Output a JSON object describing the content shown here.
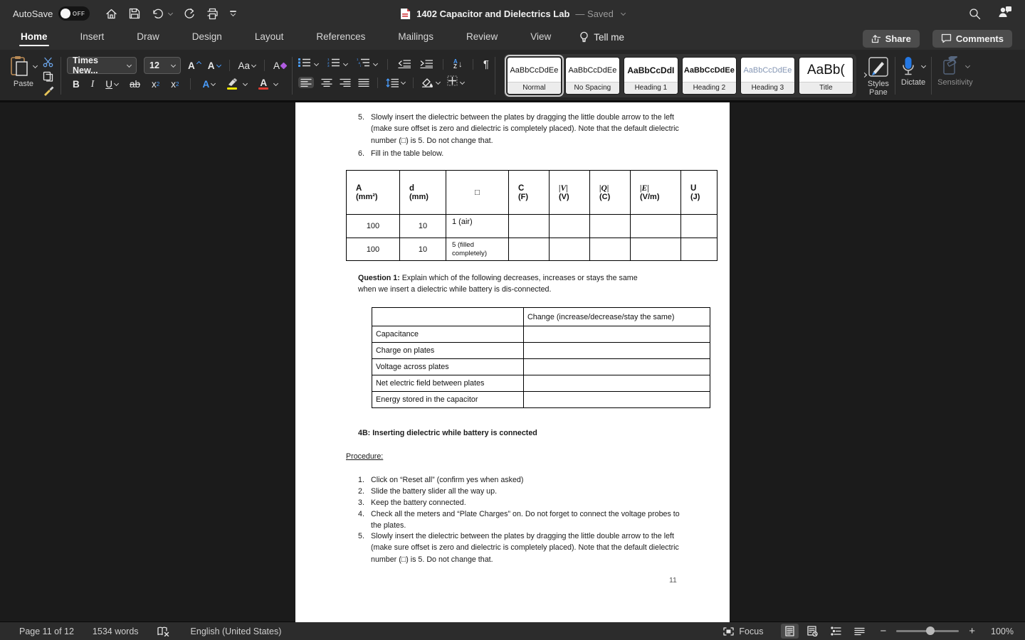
{
  "topbar": {
    "autosave_label": "AutoSave",
    "autosave_state": "OFF",
    "title": "1402 Capacitor and Dielectrics Lab",
    "title_status": "— Saved"
  },
  "tabs": [
    "Home",
    "Insert",
    "Draw",
    "Design",
    "Layout",
    "References",
    "Mailings",
    "Review",
    "View"
  ],
  "tellme_label": "Tell me",
  "header_buttons": {
    "share": "Share",
    "comments": "Comments"
  },
  "ribbon": {
    "paste_label": "Paste",
    "font_name": "Times New...",
    "font_size": "12",
    "bold": "B",
    "italic": "I",
    "underline": "U",
    "strike": "ab",
    "case_label": "Aa",
    "styles": [
      {
        "preview": "AaBbCcDdEe",
        "label": "Normal"
      },
      {
        "preview": "AaBbCcDdEe",
        "label": "No Spacing"
      },
      {
        "preview": "AaBbCcDdI",
        "label": "Heading 1"
      },
      {
        "preview": "AaBbCcDdEe",
        "label": "Heading 2"
      },
      {
        "preview": "AaBbCcDdEe",
        "label": "Heading 3"
      },
      {
        "preview": "AaBb(",
        "label": "Title"
      }
    ],
    "styles_pane_label1": "Styles",
    "styles_pane_label2": "Pane",
    "dictate_label": "Dictate",
    "sensitivity_label": "Sensitivity",
    "sort_a": "A",
    "sort_z": "Z",
    "pilcrow": "¶"
  },
  "document": {
    "intro_items": [
      {
        "num": "5.",
        "text": "Slowly insert the dielectric between the plates by dragging the little double arrow to the left (make sure offset is zero and dielectric is completely placed). Note that the default dielectric number (□) is 5. Do not change that."
      },
      {
        "num": "6.",
        "text": "Fill in the table below."
      }
    ],
    "table1": {
      "headers": [
        {
          "line1": "A",
          "line2": "(mm²)"
        },
        {
          "line1": "d",
          "line2": "(mm)"
        },
        {
          "line1": "□",
          "line2": ""
        },
        {
          "line1": "C",
          "line2": "(F)"
        },
        {
          "line1": "|V|",
          "line2": "(V)"
        },
        {
          "line1": "|Q|",
          "line2": "(C)"
        },
        {
          "line1": "|E|",
          "line2": "(V/m)"
        },
        {
          "line1": "U",
          "line2": "(J)"
        }
      ],
      "rows": [
        [
          "100",
          "10",
          "1 (air)",
          "",
          "",
          "",
          "",
          ""
        ],
        [
          "100",
          "10",
          "5 (filled completely)",
          "",
          "",
          "",
          "",
          ""
        ]
      ]
    },
    "question1_label": "Question 1:",
    "question1_text": " Explain which of the following decreases, increases or stays the same when we insert a dielectric while battery is dis-connected.",
    "table2": {
      "header": "Change (increase/decrease/stay the same)",
      "rows": [
        "Capacitance",
        "Charge on plates",
        "Voltage across plates",
        "Net electric field between plates",
        "Energy stored in the capacitor"
      ]
    },
    "section_4b": "4B: Inserting dielectric while battery is connected",
    "procedure_label": "Procedure:",
    "procedure_items": [
      {
        "num": "1.",
        "text": "Click on “Reset all” (confirm yes when asked)"
      },
      {
        "num": "2.",
        "text": "Slide the battery slider all the way up."
      },
      {
        "num": "3.",
        "text": "Keep the battery connected."
      },
      {
        "num": "4.",
        "text": "Check all the meters and “Plate Charges” on. Do not forget to connect the voltage probes to the plates."
      },
      {
        "num": "5.",
        "text": "Slowly insert the dielectric between the plates by dragging the little double arrow to the left (make sure offset is zero and dielectric is completely placed). Note that the default dielectric number (□) is 5. Do not change that."
      }
    ],
    "page_number": "11"
  },
  "statusbar": {
    "page_info": "Page 11 of 12",
    "word_count": "1534 words",
    "language": "English (United States)",
    "focus_label": "Focus",
    "zoom_level": "100%"
  },
  "colors": {
    "accent_blue": "#4a9eff",
    "dictate_blue": "#2478e4",
    "highlight_yellow": "#f3e600",
    "font_color_red": "#e03c32",
    "page_white": "#ffffff"
  }
}
